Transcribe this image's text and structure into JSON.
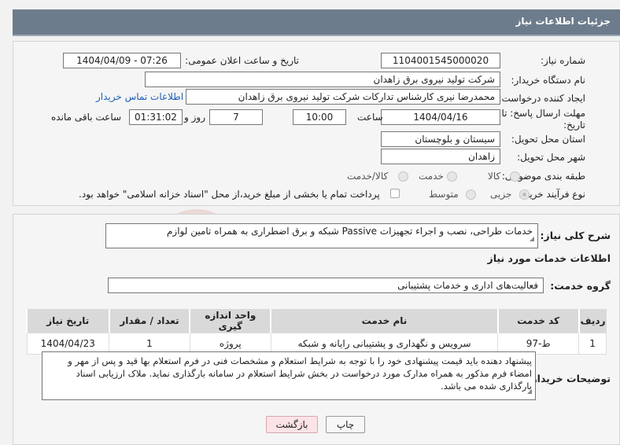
{
  "header": {
    "title": "جزئیات اطلاعات نیاز"
  },
  "need_number": {
    "label": "شماره نیاز:",
    "value": "1104001545000020"
  },
  "announce": {
    "label": "تاریخ و ساعت اعلان عمومی:",
    "value": "1404/04/09 - 07:26"
  },
  "buyer_org": {
    "label": "نام دستگاه خریدار:",
    "value": "شرکت تولید نیروی برق زاهدان"
  },
  "requester": {
    "label": "ایجاد کننده درخواست:",
    "value": "محمدرضا نیری کارشناس تدارکات شرکت تولید نیروی برق زاهدان",
    "contact_link": "اطلاعات تماس خریدار"
  },
  "deadline": {
    "label_line1": "مهلت ارسال پاسخ: تا",
    "label_line2": "تاریخ:",
    "date": "1404/04/16",
    "time_label": "ساعت",
    "time": "10:00",
    "days": "7",
    "days_label": "روز و",
    "remaining": "01:31:02",
    "remaining_label": "ساعت باقی مانده"
  },
  "province": {
    "label": "استان محل تحویل:",
    "value": "سیستان و بلوچستان"
  },
  "city": {
    "label": "شهر محل تحویل:",
    "value": "زاهدان"
  },
  "category": {
    "label": "طبقه بندی موضوعی:",
    "options": [
      "کالا",
      "خدمت",
      "کالا/خدمت"
    ],
    "selected": "خدمت"
  },
  "purchase_type": {
    "label": "نوع فرآیند خرید :",
    "options": [
      "جزیی",
      "متوسط"
    ],
    "selected": "جزیی",
    "payment_note": "پرداخت تمام یا بخشی از مبلغ خرید،از محل \"اسناد خزانه اسلامی\" خواهد بود."
  },
  "general_desc": {
    "label": "شرح کلی نیاز:",
    "value": "خدمات طراحی، نصب و اجراء تجهیزات Passive شبکه و برق اضطراری به همراه تامین لوازم"
  },
  "services_info": {
    "title": "اطلاعات خدمات مورد نیاز"
  },
  "service_group": {
    "label": "گروه خدمت:",
    "value": "فعالیت‌های اداری و خدمات پشتیبانی"
  },
  "table": {
    "headers": [
      "ردیف",
      "کد خدمت",
      "نام خدمت",
      "واحد اندازه گیری",
      "تعداد / مقدار",
      "تاریخ نیاز"
    ],
    "rows": [
      [
        "1",
        "ط-97",
        "سرویس و نگهداری و پشتیبانی رایانه و شبکه",
        "پروژه",
        "1",
        "1404/04/23"
      ]
    ]
  },
  "buyer_notes": {
    "label": "توضیحات خریدار:",
    "value": "پیشنهاد دهنده باید قیمت پیشنهادی خود را با توجه به شرایط استعلام و مشخصات فنی در فرم استعلام بها قید و پس از مهر و امضاء فرم مذکور به همراه مدارک مورد درخواست در بخش شرایط استعلام در سامانه بارگذاری نماید. ملاک ارزیابی اسناد بارگذاری شده می باشد."
  },
  "buttons": {
    "print": "چاپ",
    "back": "بازگشت"
  },
  "watermark": {
    "text": "AriaTender.neT"
  },
  "colors": {
    "header": "#6d7c8c",
    "link": "#1d5fb5",
    "back_button": "#fbe3e6",
    "watermark": "#c0392b"
  }
}
